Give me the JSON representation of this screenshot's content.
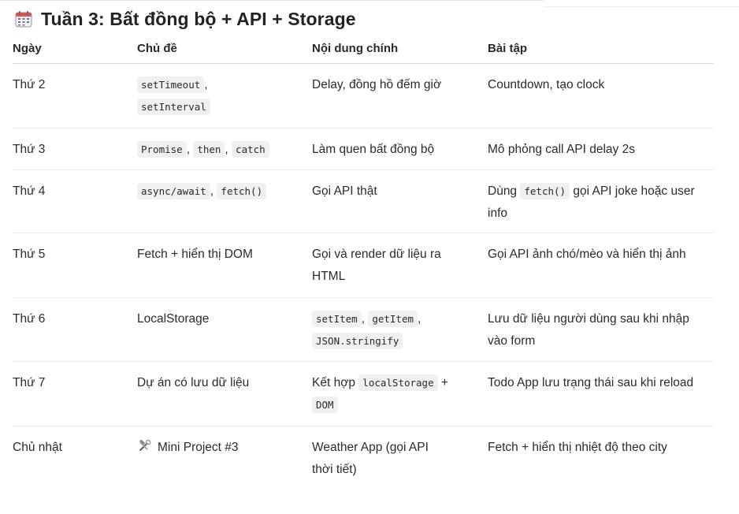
{
  "heading": {
    "icon": "calendar-icon",
    "text": "Tuần 3: Bất đồng bộ + API + Storage"
  },
  "columns": [
    "Ngày",
    "Chủ đề",
    "Nội dung chính",
    "Bài tập"
  ],
  "rows": [
    {
      "day": "Thứ 2",
      "topic_codes": [
        "setTimeout",
        "setInterval"
      ],
      "content": "Delay, đồng hồ đếm giờ",
      "exercise": "Countdown, tạo clock"
    },
    {
      "day": "Thứ 3",
      "topic_codes": [
        "Promise",
        "then",
        "catch"
      ],
      "content": "Làm quen bất đồng bộ",
      "exercise": "Mô phỏng call API delay 2s"
    },
    {
      "day": "Thứ 4",
      "topic_codes": [
        "async/await",
        "fetch()"
      ],
      "content": "Gọi API thật",
      "exercise_prefix": "Dùng",
      "exercise_code": "fetch()",
      "exercise_suffix": "gọi API joke hoặc user",
      "exercise_line2": "info"
    },
    {
      "day": "Thứ 5",
      "topic": "Fetch + hiển thị DOM",
      "content_line1": "Gọi và render dữ liệu ra",
      "content_line2": "HTML",
      "exercise": "Gọi API ảnh chó/mèo và hiển thị ảnh"
    },
    {
      "day": "Thứ 6",
      "topic": "LocalStorage",
      "content_codes": [
        "setItem",
        "getItem",
        "JSON.stringify"
      ],
      "exercise_line1": "Lưu dữ liệu người dùng sau khi nhập",
      "exercise_line2": "vào form"
    },
    {
      "day": "Thứ 7",
      "topic": "Dự án có lưu dữ liệu",
      "content_prefix": "Kết hợp",
      "content_code1": "localStorage",
      "content_plus": "+",
      "content_code2": "DOM",
      "exercise": "Todo App lưu trạng thái sau khi reload"
    },
    {
      "day": "Chủ nhật",
      "topic_icon": "hammer-wrench-icon",
      "topic": "Mini Project #3",
      "content_line1": "Weather App (gọi API",
      "content_line2": "thời tiết)",
      "exercise": "Fetch + hiển thị nhiệt độ theo city"
    }
  ],
  "separators": {
    "comma": ","
  }
}
